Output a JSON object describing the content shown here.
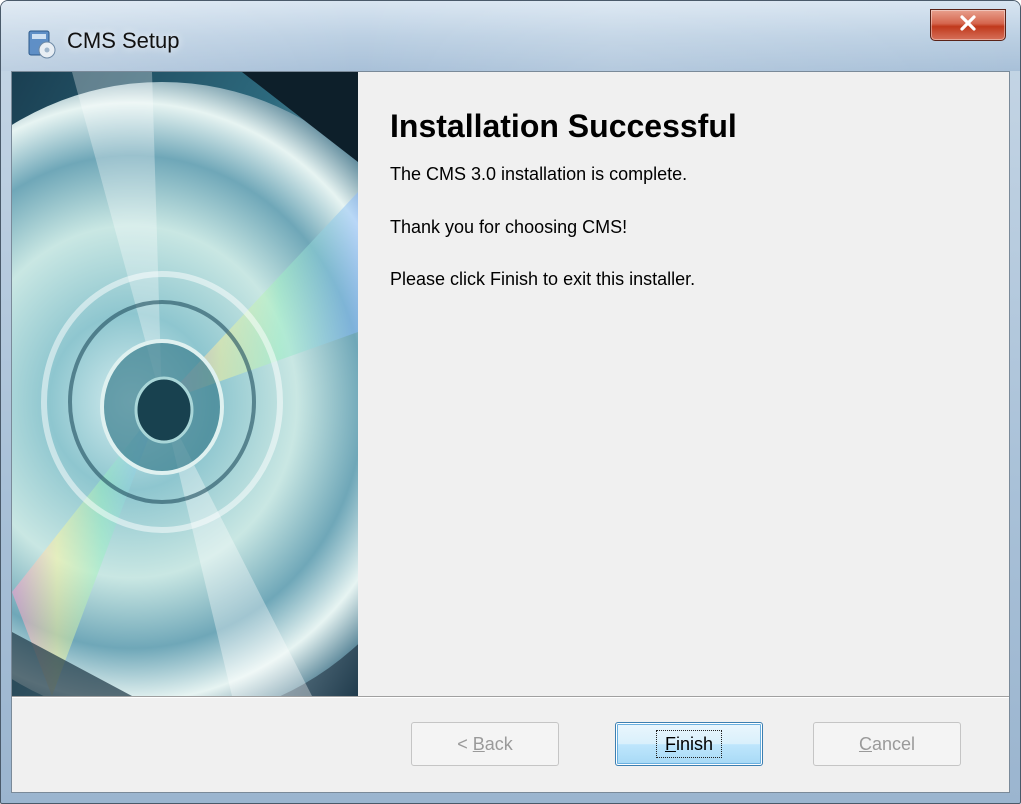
{
  "window": {
    "title": "CMS Setup",
    "close_glyph": "x"
  },
  "wizard": {
    "heading": "Installation Successful",
    "lines": [
      "The CMS 3.0 installation is complete.",
      "Thank you for choosing CMS!",
      "Please click Finish to exit this installer."
    ]
  },
  "buttons": {
    "back": {
      "prefix": "< ",
      "mnemonic": "B",
      "rest": "ack",
      "enabled": false
    },
    "finish": {
      "prefix": "",
      "mnemonic": "F",
      "rest": "inish",
      "enabled": true,
      "default": true
    },
    "cancel": {
      "prefix": "",
      "mnemonic": "C",
      "rest": "ancel",
      "enabled": false
    }
  },
  "icons": {
    "app": "setup-installer-icon",
    "close": "close-icon",
    "banner": "cd-disc-image"
  },
  "colors": {
    "close_button": "#c7452b",
    "default_button_border": "#3c7fb1",
    "disabled_text": "#9a9a9a"
  }
}
